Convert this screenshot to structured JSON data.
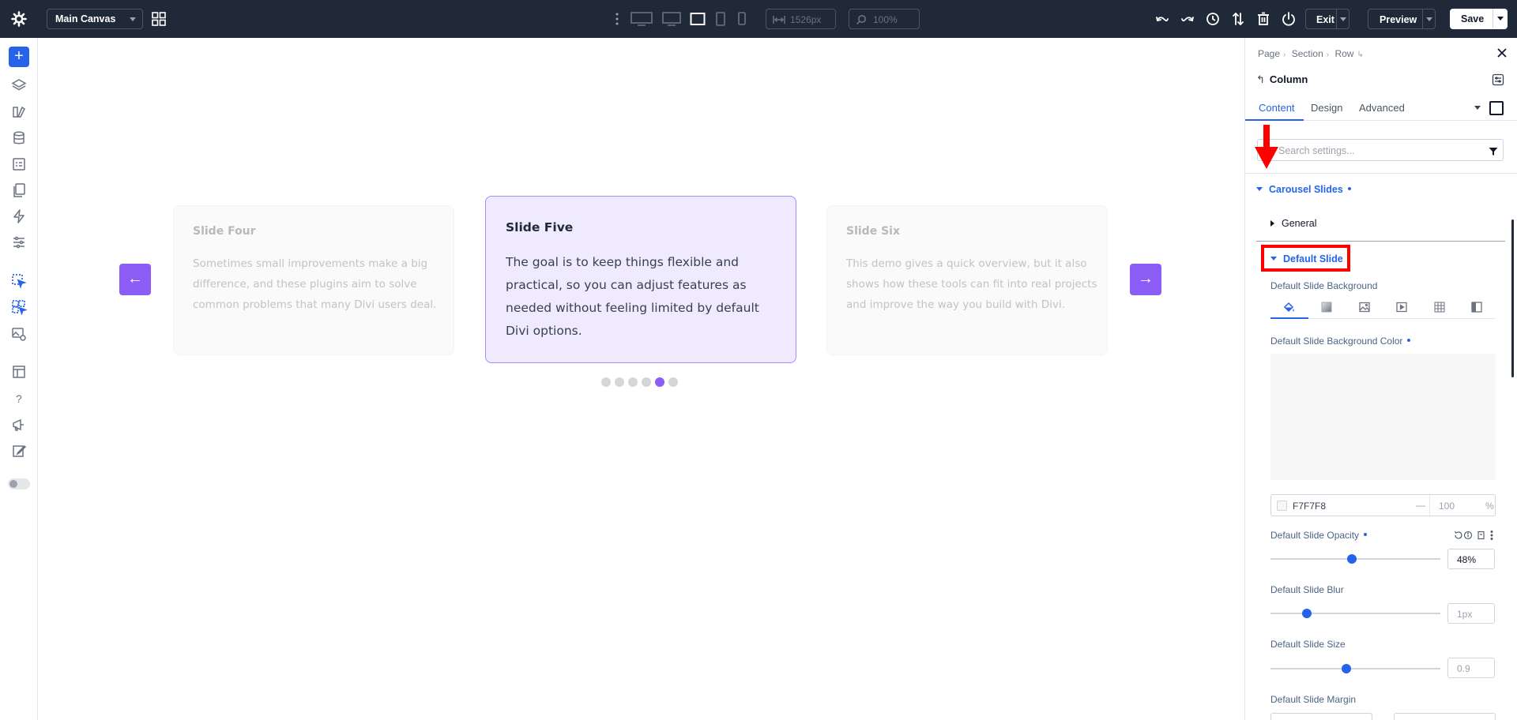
{
  "topbar": {
    "canvas_select": "Main Canvas",
    "width_readout": "1526px",
    "zoom_readout": "100%",
    "exit_label": "Exit",
    "preview_label": "Preview",
    "save_label": "Save"
  },
  "canvas": {
    "prev_arrow": "←",
    "next_arrow": "→",
    "slides": [
      {
        "title": "Slide Four",
        "body": "Sometimes small improvements make a big difference, and these plugins aim to solve common problems that many Divi users deal."
      },
      {
        "title": "Slide Five",
        "body": "The goal is to keep things flexible and practical, so you can adjust features as needed without feeling limited by default Divi options."
      },
      {
        "title": "Slide Six",
        "body": "This demo gives a quick overview, but it also shows how these tools can fit into real projects and improve the way you build with Divi."
      }
    ],
    "dots_total": 6,
    "dots_active_index": 4
  },
  "panel": {
    "breadcrumb": [
      "Page",
      "Section",
      "Row"
    ],
    "element_title": "Column",
    "tabs": [
      "Content",
      "Design",
      "Advanced"
    ],
    "active_tab": "Content",
    "search_placeholder": "Search settings...",
    "section_title": "Carousel Slides",
    "group_general": "General",
    "group_default_slide": "Default Slide",
    "bg_label": "Default Slide Background",
    "bg_color_label": "Default Slide Background Color",
    "bg_color_hex": "F7F7F8",
    "bg_color_dash": "—",
    "bg_color_opacity": "100",
    "bg_color_pct": "%",
    "opacity_label": "Default Slide Opacity",
    "opacity_value": "48%",
    "opacity_fraction": 0.48,
    "blur_label": "Default Slide Blur",
    "blur_value": "1px",
    "size_label": "Default Slide Size",
    "size_value": "0.9",
    "margin_label": "Default Slide Margin"
  },
  "colors": {
    "accent": "#2563eb",
    "purple": "#8b5cf6",
    "topbar": "#1f2937",
    "highlight": "#ff0000"
  }
}
